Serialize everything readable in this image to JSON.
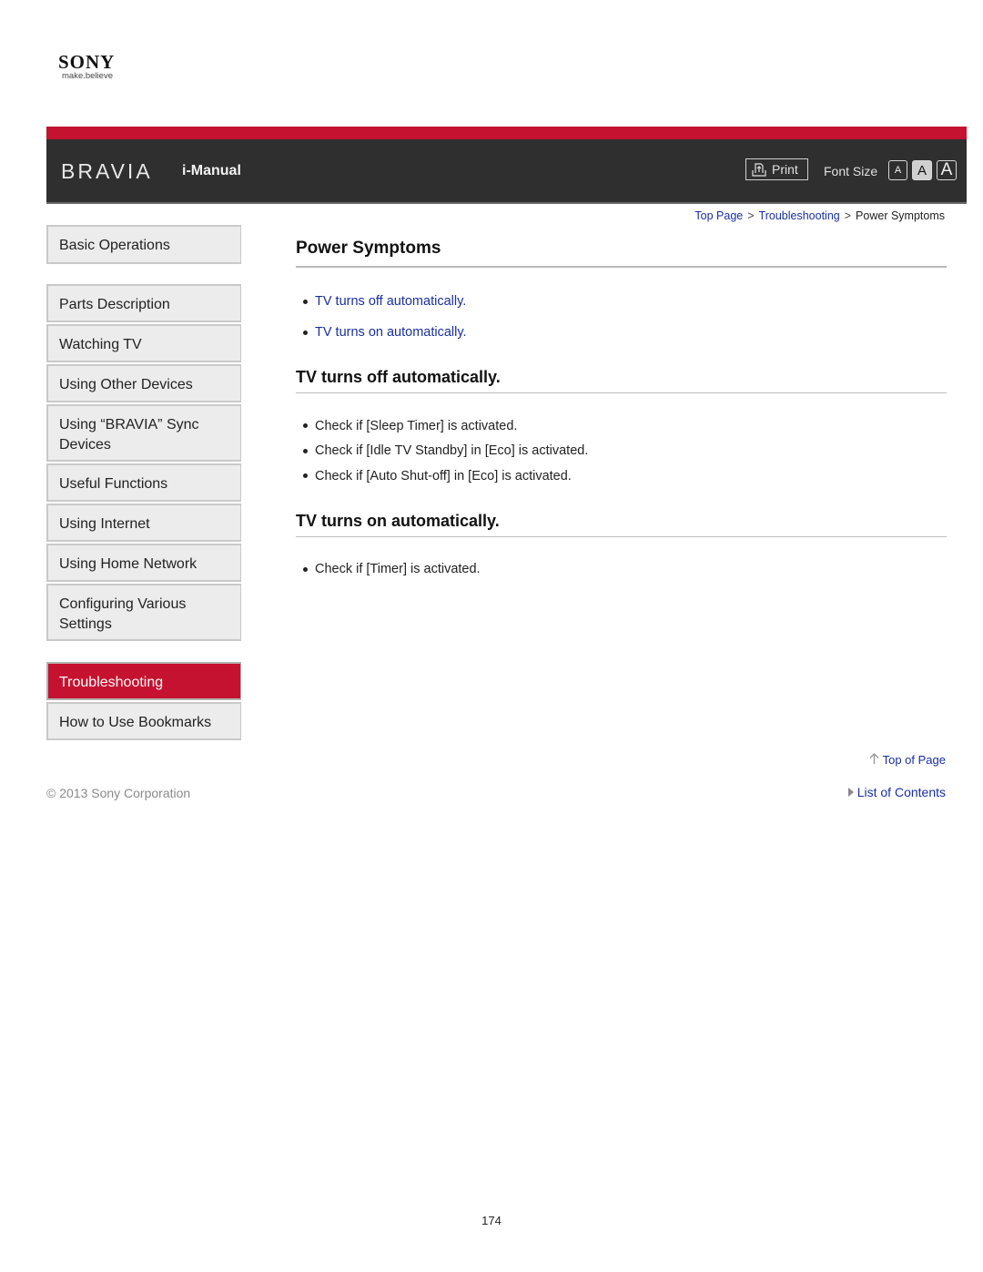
{
  "brand": {
    "company": "SONY",
    "tagline": "make.believe",
    "product": "BRAVIA",
    "app_title": "i-Manual"
  },
  "colors": {
    "accent_red": "#c41230",
    "header_bg": "#2f2f2f",
    "link_blue": "#1a2fa0",
    "nav_bg": "#ececec"
  },
  "toolbar": {
    "print_label": "Print",
    "print_icon": "printer-icon",
    "font_size_label": "Font Size",
    "font_size_options": [
      "A",
      "A",
      "A"
    ],
    "font_size_selected": "medium"
  },
  "breadcrumb": {
    "items": [
      "Top Page",
      "Troubleshooting"
    ],
    "separator": ">",
    "current": "Power Symptoms"
  },
  "sidebar": {
    "items": [
      {
        "label": "Basic Operations",
        "active": false
      },
      {
        "label": "Parts Description",
        "active": false
      },
      {
        "label": "Watching TV",
        "active": false
      },
      {
        "label": "Using Other Devices",
        "active": false
      },
      {
        "label": "Using “BRAVIA” Sync Devices",
        "active": false
      },
      {
        "label": "Useful Functions",
        "active": false
      },
      {
        "label": "Using Internet",
        "active": false
      },
      {
        "label": "Using Home Network",
        "active": false
      },
      {
        "label": "Configuring Various Settings",
        "active": false
      },
      {
        "label": "Troubleshooting",
        "active": true
      },
      {
        "label": "How to Use Bookmarks",
        "active": false
      }
    ]
  },
  "main": {
    "title": "Power Symptoms",
    "toc": [
      "TV turns off automatically.",
      "TV turns on automatically."
    ],
    "sections": [
      {
        "title": "TV turns off automatically.",
        "items": [
          "Check if [Sleep Timer] is activated.",
          "Check if [Idle TV Standby] in [Eco] is activated.",
          "Check if [Auto Shut-off] in [Eco] is activated."
        ]
      },
      {
        "title": "TV turns on automatically.",
        "items": [
          "Check if [Timer] is activated."
        ]
      }
    ]
  },
  "footer": {
    "copyright": "© 2013 Sony Corporation",
    "top_of_page": "Top of Page",
    "list_of_contents": "List of Contents",
    "page_number": "174"
  }
}
